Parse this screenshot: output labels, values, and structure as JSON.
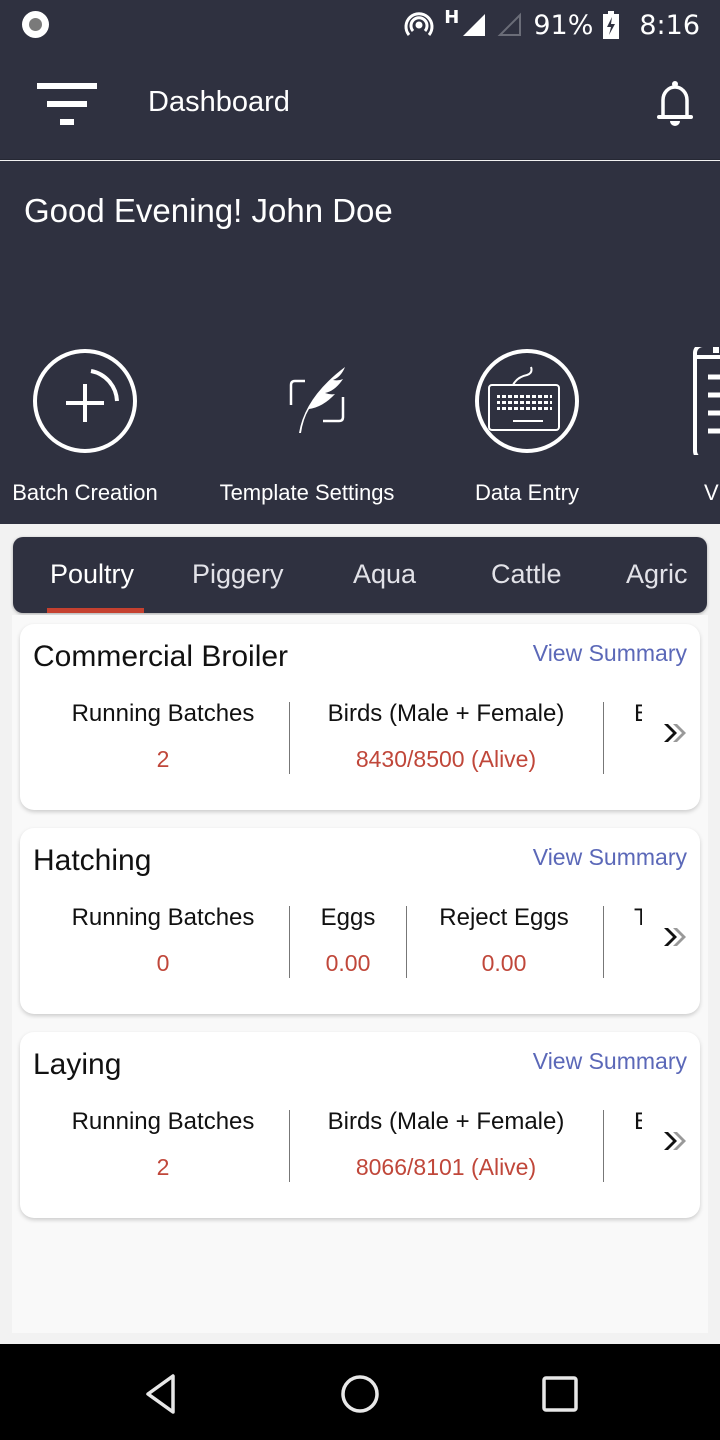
{
  "status_bar": {
    "battery": "91%",
    "time": "8:16",
    "network_type": "H",
    "icons": [
      "screen-record-icon",
      "hotspot-icon",
      "signal-full-icon",
      "signal-empty-icon",
      "battery-charging-icon"
    ]
  },
  "app_bar": {
    "title": "Dashboard",
    "icons": [
      "filter-menu-icon",
      "bell-icon"
    ]
  },
  "hero": {
    "greeting": "Good Evening! John Doe",
    "quick_actions": [
      {
        "label": "Batch Creation",
        "icon": "add-circle-icon"
      },
      {
        "label": "Template Settings",
        "icon": "feather-icon"
      },
      {
        "label": "Data Entry",
        "icon": "keyboard-icon"
      },
      {
        "label": "V",
        "icon": "clipboard-icon"
      }
    ]
  },
  "tabs": {
    "items": [
      "Poultry",
      "Piggery",
      "Aqua",
      "Cattle",
      "Agric"
    ],
    "active": "Poultry"
  },
  "colors": {
    "primary_dark": "#2f3140",
    "accent_red": "#c5402f",
    "value_red": "#c0473a",
    "link_blue": "#5b68b8"
  },
  "cards": [
    {
      "title": "Commercial Broiler",
      "link": "View Summary",
      "metrics": [
        {
          "label": "Running Batches",
          "value": "2"
        },
        {
          "label": "Birds (Male + Female)",
          "value": "8430/8500 (Alive)"
        }
      ],
      "clipped_label": "E"
    },
    {
      "title": "Hatching",
      "link": "View Summary",
      "metrics": [
        {
          "label": "Running Batches",
          "value": "0"
        },
        {
          "label": "Eggs",
          "value": "0.00"
        },
        {
          "label": "Reject Eggs",
          "value": "0.00"
        }
      ],
      "clipped_label": "T"
    },
    {
      "title": "Laying",
      "link": "View Summary",
      "metrics": [
        {
          "label": "Running Batches",
          "value": "2"
        },
        {
          "label": "Birds (Male + Female)",
          "value": "8066/8101 (Alive)"
        }
      ],
      "clipped_label": "E"
    }
  ],
  "nav_bar": {
    "buttons": [
      "back",
      "home",
      "recents"
    ]
  }
}
